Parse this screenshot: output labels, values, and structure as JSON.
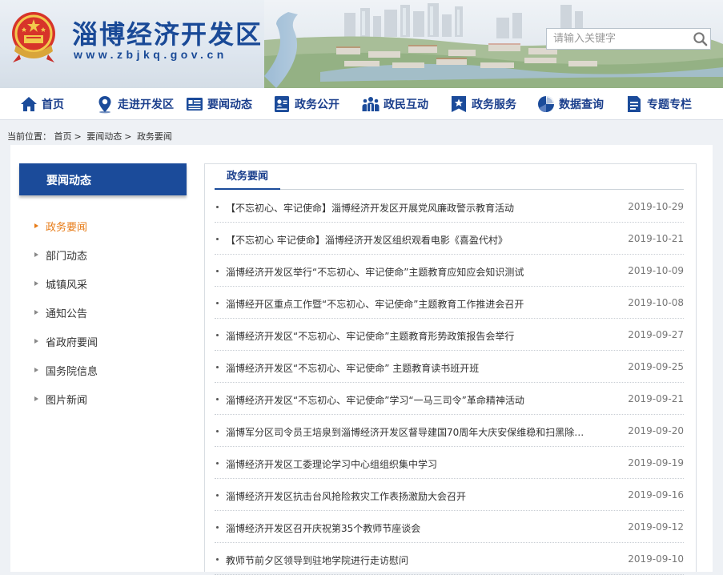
{
  "header": {
    "site_title": "淄博经济开发区",
    "site_url": "www.zbjkq.gov.cn",
    "search_placeholder": "请输入关键字",
    "search_icon": "search-icon",
    "brand_color": "#1a4a97"
  },
  "nav": {
    "items": [
      {
        "label": "首页",
        "icon": "home-icon"
      },
      {
        "label": "走进开发区",
        "icon": "location-pin-icon"
      },
      {
        "label": "要闻动态",
        "icon": "news-icon"
      },
      {
        "label": "政务公开",
        "icon": "id-card-icon"
      },
      {
        "label": "政民互动",
        "icon": "people-icon"
      },
      {
        "label": "政务服务",
        "icon": "star-bookmark-icon"
      },
      {
        "label": "数据查询",
        "icon": "pie-chart-icon"
      },
      {
        "label": "专题专栏",
        "icon": "document-icon"
      }
    ],
    "text_color": "#1a3e8c"
  },
  "breadcrumb": {
    "prefix": "当前位置：",
    "items": [
      "首页",
      "要闻动态",
      "政务要闻"
    ],
    "separator": ">"
  },
  "sidebar": {
    "title": "要闻动态",
    "items": [
      {
        "label": "政务要闻",
        "active": true
      },
      {
        "label": "部门动态",
        "active": false
      },
      {
        "label": "城镇风采",
        "active": false
      },
      {
        "label": "通知公告",
        "active": false
      },
      {
        "label": "省政府要闻",
        "active": false
      },
      {
        "label": "国务院信息",
        "active": false
      },
      {
        "label": "图片新闻",
        "active": false
      }
    ],
    "active_color": "#e77b17",
    "header_color": "#1b4b9a"
  },
  "content": {
    "tab_label": "政务要闻",
    "news": [
      {
        "title": "【不忘初心、牢记使命】淄博经济开发区开展党风廉政警示教育活动",
        "date": "2019-10-29"
      },
      {
        "title": "【不忘初心 牢记使命】淄博经济开发区组织观看电影《喜盈代村》",
        "date": "2019-10-21"
      },
      {
        "title": "淄博经济开发区举行“不忘初心、牢记使命”主题教育应知应会知识测试",
        "date": "2019-10-09"
      },
      {
        "title": "淄博经开区重点工作暨“不忘初心、牢记使命”主题教育工作推进会召开",
        "date": "2019-10-08"
      },
      {
        "title": "淄博经济开发区“不忘初心、牢记使命”主题教育形势政策报告会举行",
        "date": "2019-09-27"
      },
      {
        "title": "淄博经济开发区“不忘初心、牢记使命” 主题教育读书班开班",
        "date": "2019-09-25"
      },
      {
        "title": "淄博经济开发区“不忘初心、牢记使命”学习“一马三司令”革命精神活动",
        "date": "2019-09-21"
      },
      {
        "title": "淄博军分区司令员王培泉到淄博经济开发区督导建国70周年大庆安保维稳和扫黑除恶...",
        "date": "2019-09-20"
      },
      {
        "title": "淄博经济开发区工委理论学习中心组组织集中学习",
        "date": "2019-09-19"
      },
      {
        "title": "淄博经济开发区抗击台风抢险救灾工作表扬激励大会召开",
        "date": "2019-09-16"
      },
      {
        "title": "淄博经济开发区召开庆祝第35个教师节座谈会",
        "date": "2019-09-12"
      },
      {
        "title": "教师节前夕区领导到驻地学院进行走访慰问",
        "date": "2019-09-10"
      }
    ]
  }
}
